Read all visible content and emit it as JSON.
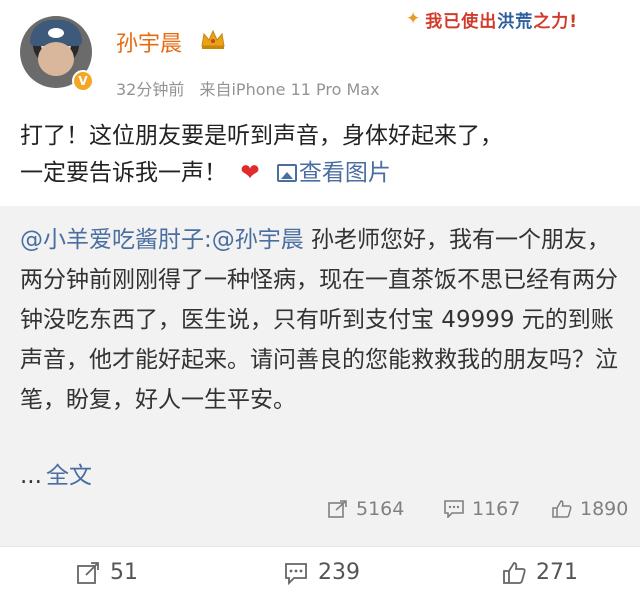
{
  "sticker": {
    "prefix": "我已使出",
    "highlight": "洪荒",
    "suffix": "之力!"
  },
  "user": {
    "name": "孙宇晨",
    "verified_badge": "V"
  },
  "meta": {
    "time": "32分钟前",
    "source": "来自iPhone 11 Pro Max"
  },
  "post": {
    "line1": "打了！这位朋友要是听到声音，身体好起来了，",
    "line2": "一定要告诉我一声！",
    "view_pics": "查看图片"
  },
  "repost": {
    "author": "@小羊爱吃酱肘子",
    "sep": ":",
    "mention": "@孙宇晨",
    "text": " 孙老师您好，我有一个朋友，两分钟前刚刚得了一种怪病，现在一直茶饭不思已经有两分钟没吃东西了，医生说，只有听到支付宝 49999 元的到账声音，他才能好起来。请问善良的您能救救我的朋友吗？泣笔，盼复，好人一生平安。",
    "more_prefix": "...",
    "full_text": "全文",
    "reposts": "5164",
    "comments": "1167",
    "likes": "1890"
  },
  "actions": {
    "reposts": "51",
    "comments": "239",
    "likes": "271"
  },
  "icons": [
    "crown-icon",
    "heart-icon",
    "picture-icon",
    "repost-icon",
    "comment-icon",
    "like-icon"
  ],
  "colors": {
    "name": "#e86a10",
    "link": "#4a6ea0",
    "heart": "#e02b2b",
    "repost_bg": "#f2f2f2"
  }
}
